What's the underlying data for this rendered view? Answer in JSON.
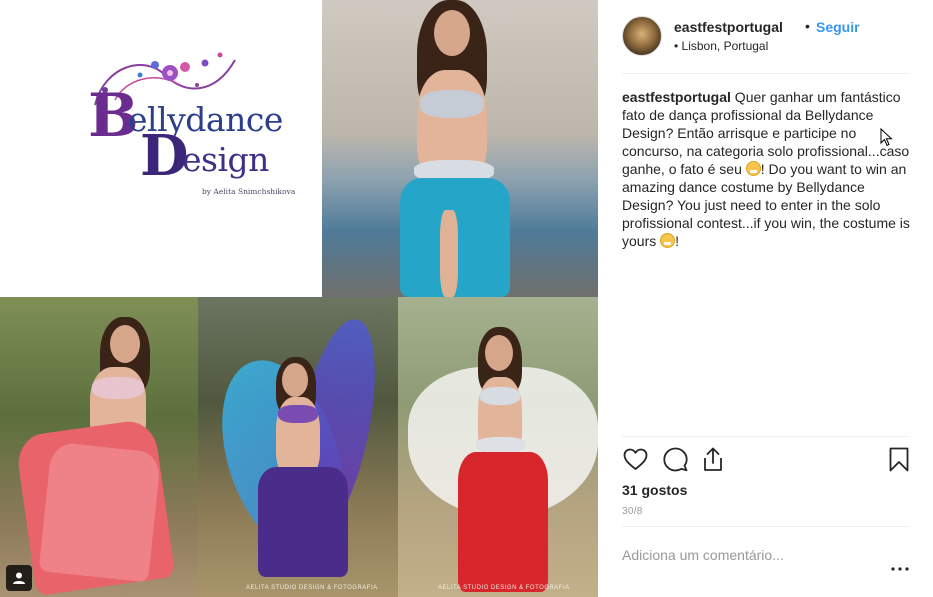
{
  "post": {
    "username": "eastfestportugal",
    "separator": "•",
    "follow_label": "Seguir",
    "location_bullet": "•",
    "location": "Lisbon, Portugal",
    "avatar_icon": "avatar-photo"
  },
  "caption": {
    "username": "eastfestportugal",
    "text_part1": " Quer ganhar um fantástico fato de dança profissional da Bellydance Design? Então arrisque e participe no concurso, na categoria solo profissional...caso ganhe, o fato é seu ",
    "text_part2": "! Do you want to win an amazing dance costume by Bellydance Design? You just need to enter in the solo profissional contest...if you win, the costume is yours ",
    "text_part3": "!"
  },
  "logo": {
    "line1": "ellydance",
    "line2": "esign",
    "big_b": "B",
    "big_d": "D",
    "byline": "by Aelita Snimchshikova"
  },
  "watermarks": {
    "bottom_middle": "AELITA STUDIO DESIGN & FOTOGRAFIA",
    "bottom_right": "AELITA STUDIO DESIGN & FOTOGRAFIA"
  },
  "actions": {
    "like_icon": "heart-icon",
    "comment_icon": "comment-icon",
    "share_icon": "share-icon",
    "save_icon": "bookmark-icon"
  },
  "likes": "31 gostos",
  "date": "30/8",
  "comment": {
    "placeholder": "Adiciona um comentário..."
  },
  "more": {
    "icon": "more-options-icon"
  },
  "colors": {
    "link": "#3897f0",
    "text": "#262626",
    "muted": "#999999",
    "divider": "#efefef"
  }
}
